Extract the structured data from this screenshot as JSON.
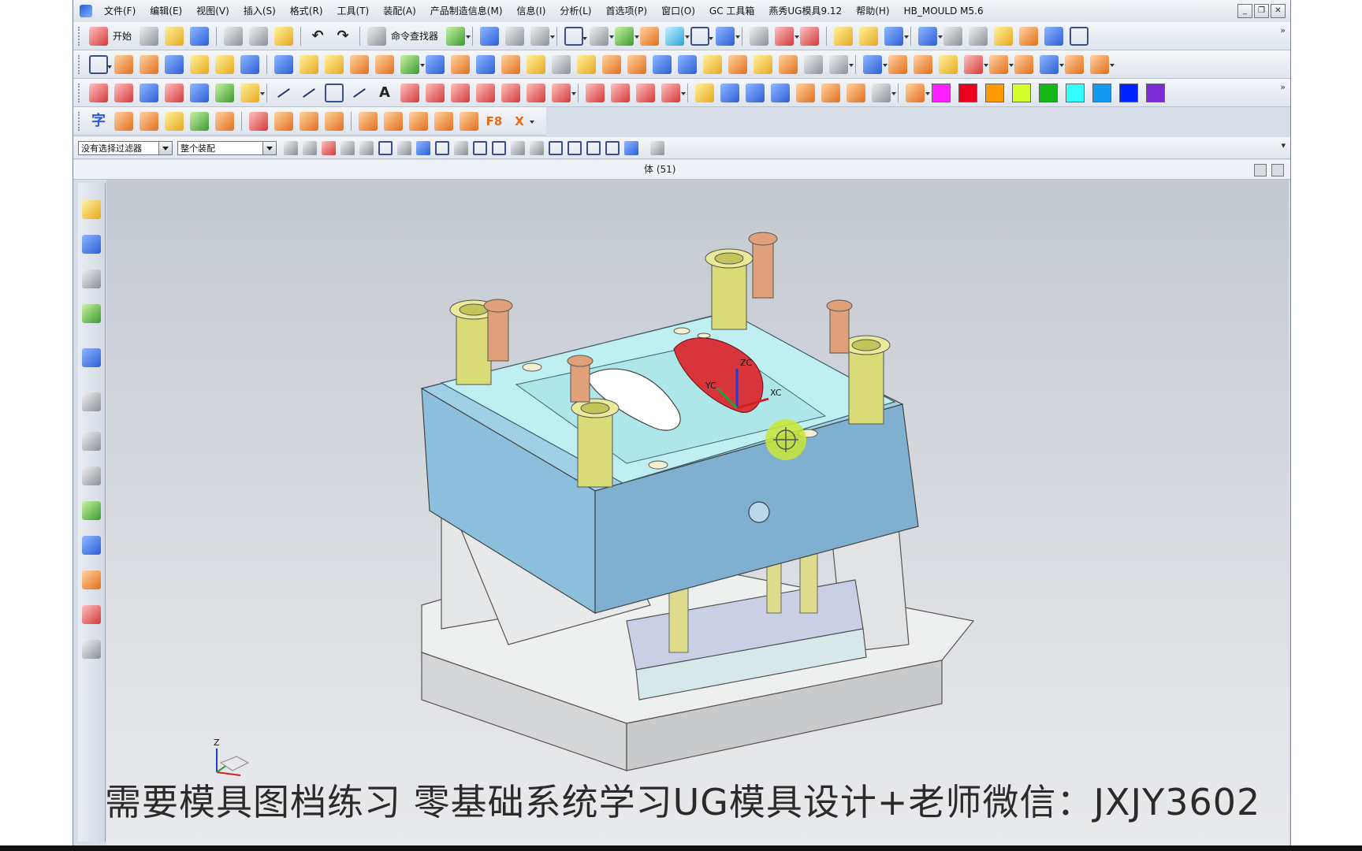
{
  "menubar": {
    "items": [
      "文件(F)",
      "编辑(E)",
      "视图(V)",
      "插入(S)",
      "格式(R)",
      "工具(T)",
      "装配(A)",
      "产品制造信息(M)",
      "信息(I)",
      "分析(L)",
      "首选项(P)",
      "窗口(O)",
      "GC 工具箱",
      "燕秀UG模具9.12",
      "帮助(H)",
      "HB_MOULD M5.6"
    ]
  },
  "toolbar1": {
    "start_label": "开始",
    "command_finder_label": "命令查找器"
  },
  "selection": {
    "filter_value": "没有选择过滤器",
    "scope_value": "整个装配"
  },
  "status": {
    "text": "体 (51)"
  },
  "swatches": [
    "#ff22ff",
    "#e8001e",
    "#ff9a00",
    "#d4ff2e",
    "#14b814",
    "#34ffff",
    "#139af0",
    "#0022ff",
    "#7a2bd6"
  ],
  "model": {
    "triad_labels": [
      "YC",
      "XC",
      "ZC"
    ],
    "axis_label": "Z"
  },
  "watermark": "需要模具图档练习 零基础系统学习UG模具设计+老师微信：JXJY3602"
}
